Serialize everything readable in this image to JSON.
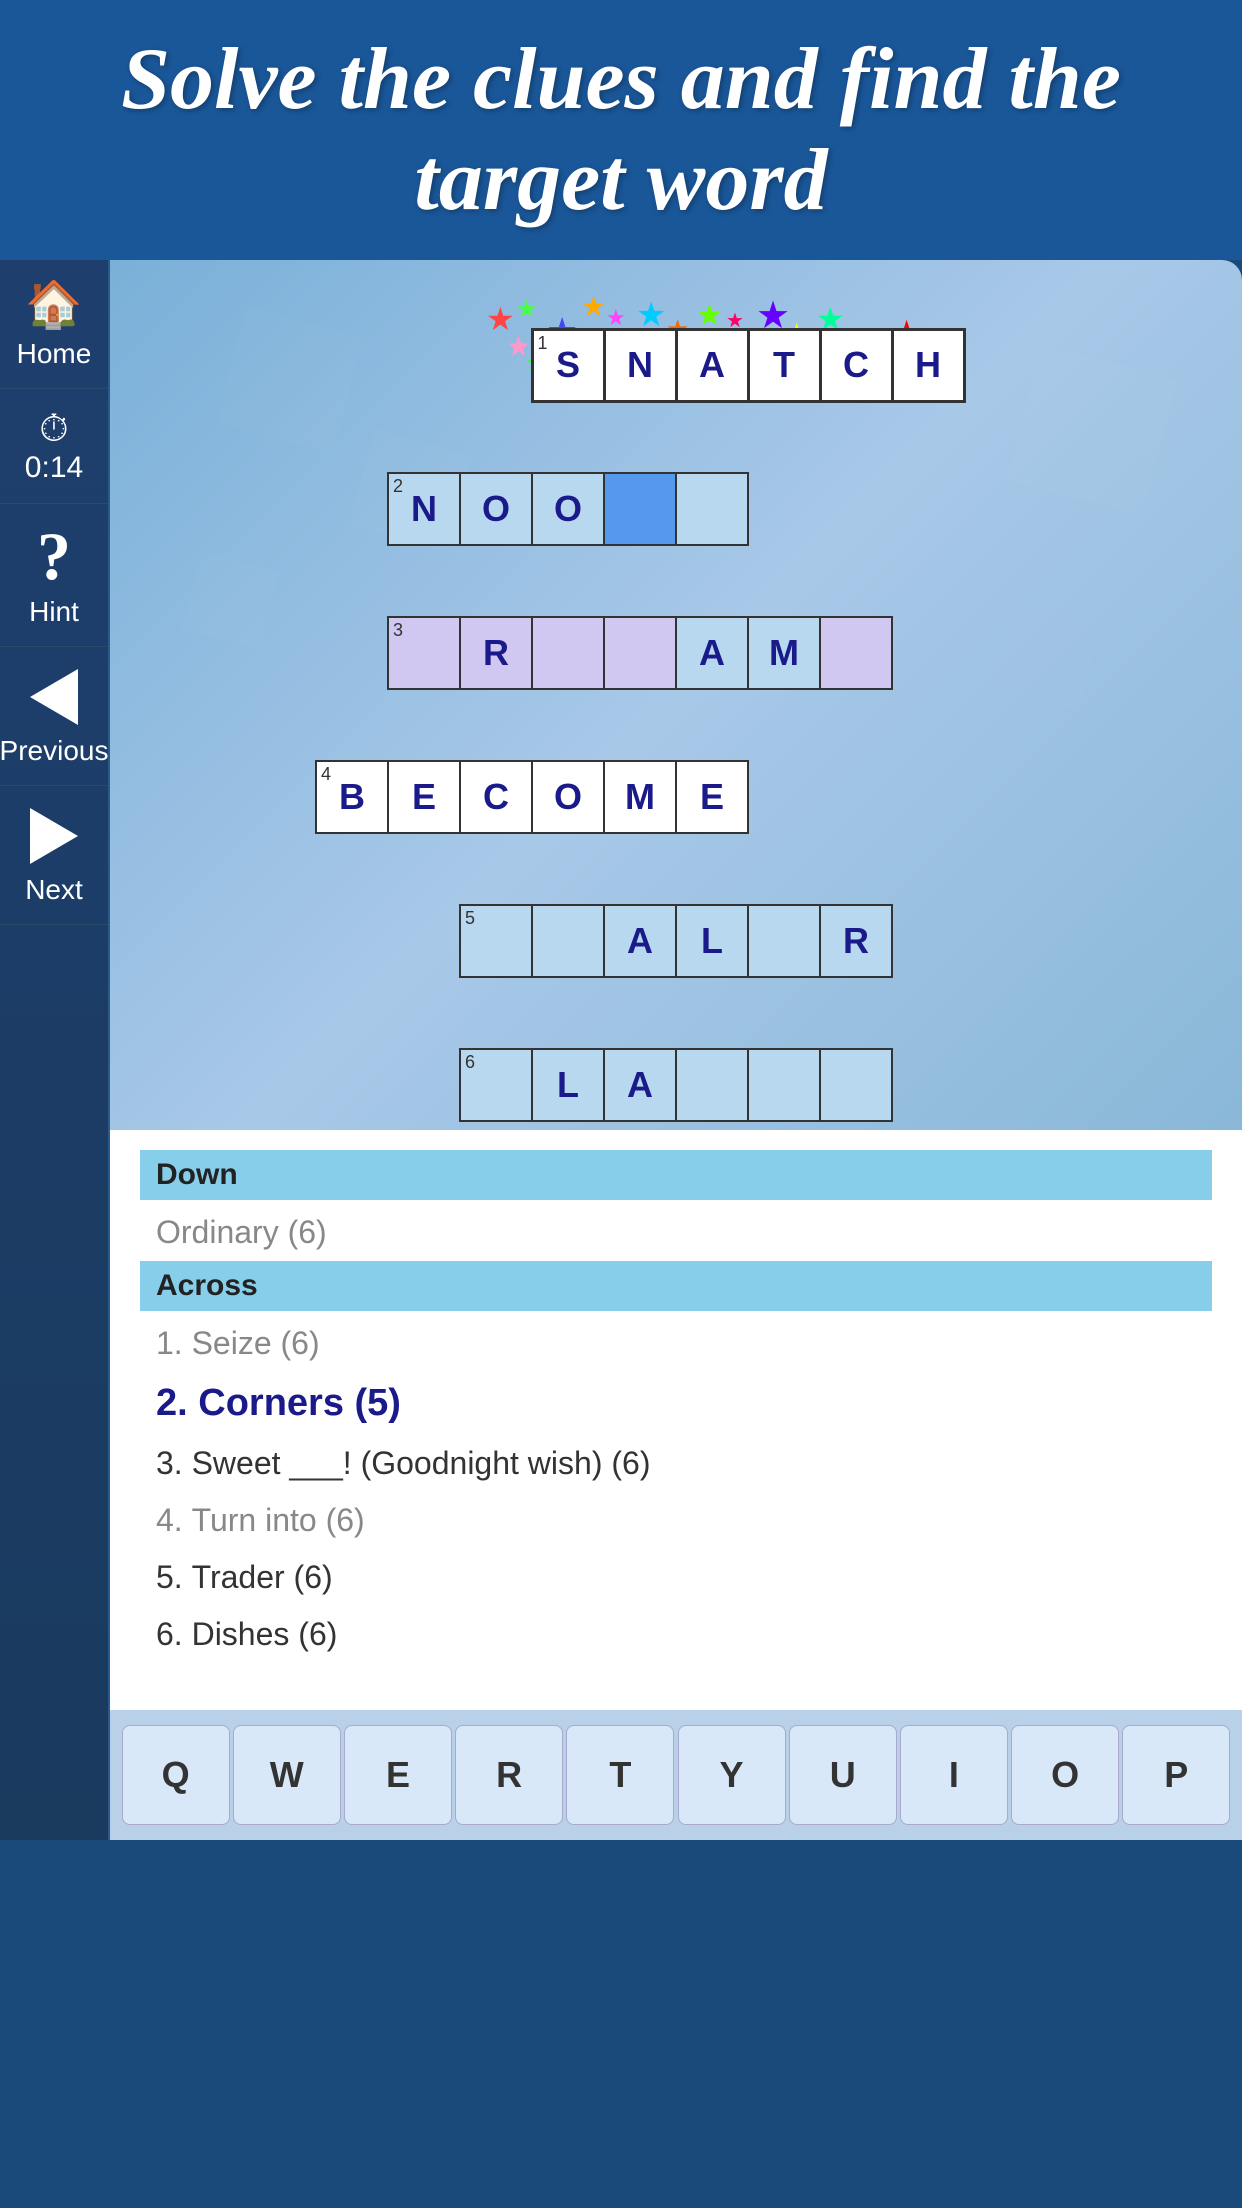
{
  "header": {
    "title": "Solve the clues and find the target word"
  },
  "sidebar": {
    "home_label": "Home",
    "timer_label": "0:14",
    "hint_label": "Hint",
    "previous_label": "Previous",
    "next_label": "Next"
  },
  "puzzle": {
    "rows": [
      [
        null,
        null,
        null,
        "S",
        "N",
        "A",
        "T",
        "C",
        "H",
        null
      ],
      [
        null,
        null,
        null,
        null,
        null,
        null,
        null,
        null,
        null,
        null
      ],
      [
        "N",
        "O",
        null,
        "O",
        null,
        null,
        null,
        null,
        null,
        null
      ],
      [
        null,
        null,
        null,
        null,
        null,
        null,
        null,
        null,
        null,
        null
      ],
      [
        null,
        "R",
        null,
        null,
        null,
        "A",
        "M",
        null,
        null,
        null
      ],
      [
        null,
        null,
        null,
        null,
        null,
        null,
        null,
        null,
        null,
        null
      ],
      [
        "B",
        "E",
        "C",
        "O",
        "M",
        "E",
        null,
        null,
        null,
        null
      ],
      [
        null,
        null,
        null,
        null,
        null,
        null,
        null,
        null,
        null,
        null
      ],
      [
        null,
        null,
        "A",
        null,
        "L",
        null,
        null,
        "R",
        null,
        null
      ],
      [
        null,
        null,
        null,
        null,
        null,
        null,
        null,
        null,
        null,
        null
      ],
      [
        null,
        null,
        "L",
        null,
        "A",
        null,
        null,
        null,
        null,
        null
      ]
    ]
  },
  "clues": {
    "down_header": "Down",
    "down_items": [
      {
        "text": "Ordinary (6)",
        "active": false,
        "done": true
      }
    ],
    "across_header": "Across",
    "across_items": [
      {
        "num": "1.",
        "text": "Seize (6)",
        "active": false,
        "done": true
      },
      {
        "num": "2.",
        "text": "Corners (5)",
        "active": true,
        "done": false
      },
      {
        "num": "3.",
        "text": "Sweet ___! (Goodnight wish) (6)",
        "active": false,
        "done": false
      },
      {
        "num": "4.",
        "text": "Turn into (6)",
        "active": false,
        "done": true
      },
      {
        "num": "5.",
        "text": "Trader (6)",
        "active": false,
        "done": false
      },
      {
        "num": "6.",
        "text": "Dishes (6)",
        "active": false,
        "done": false
      }
    ]
  },
  "keyboard": {
    "keys": [
      "Q",
      "W",
      "E",
      "R",
      "T",
      "Y",
      "U",
      "I",
      "O",
      "P"
    ]
  },
  "colors": {
    "accent": "#1a5799",
    "light_blue": "#87ceeb",
    "active_cell": "#5599ee"
  }
}
